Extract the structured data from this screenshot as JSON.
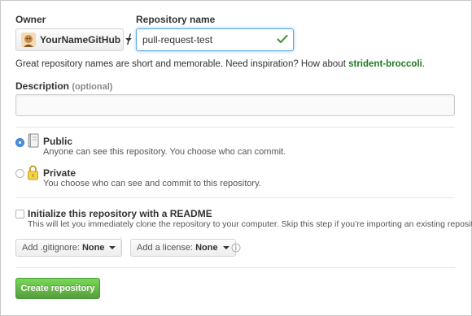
{
  "owner": {
    "label": "Owner",
    "selected": "YourNameGitHub"
  },
  "repo_name": {
    "label": "Repository name",
    "value": "pull-request-test",
    "valid_icon": "check-icon",
    "valid_color": "#4a993e"
  },
  "slash": "/",
  "hint": {
    "text": "Great repository names are short and memorable. Need inspiration? How about ",
    "suggestion": "strident-broccoli",
    "suffix": "."
  },
  "description": {
    "label": "Description",
    "optional": "(optional)",
    "value": ""
  },
  "visibility": {
    "public": {
      "title": "Public",
      "text": "Anyone can see this repository. You choose who can commit.",
      "selected": true,
      "icon": "repo-book-icon"
    },
    "private": {
      "title": "Private",
      "text": "You choose who can see and commit to this repository.",
      "selected": false,
      "icon": "lock-icon"
    }
  },
  "init": {
    "title": "Initialize this repository with a README",
    "text": "This will let you immediately clone the repository to your computer. Skip this step if you’re importing an existing repository.",
    "checked": false
  },
  "gitignore": {
    "label": "Add .gitignore:",
    "value": "None"
  },
  "license": {
    "label": "Add a license:",
    "value": "None"
  },
  "create_button": "Create repository",
  "colors": {
    "accent_blue": "#4a90e2",
    "primary_green": "#6cc644",
    "suggestion_green": "#1e7a1e"
  }
}
